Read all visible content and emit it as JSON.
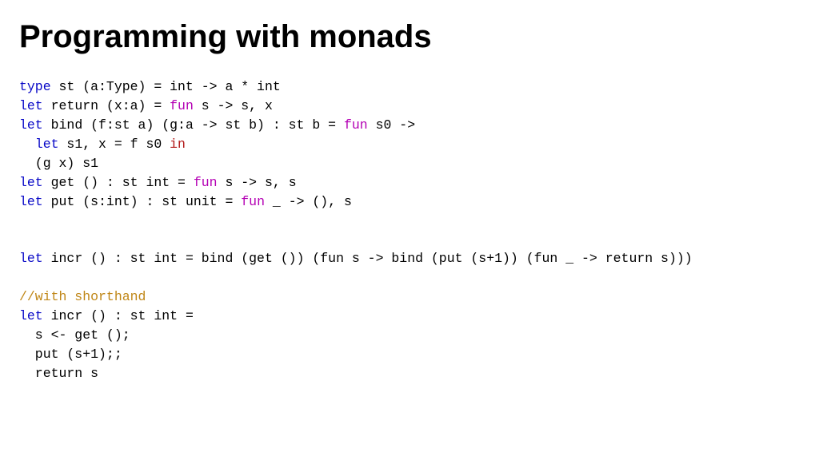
{
  "title": "Programming with monads",
  "code": {
    "l1": {
      "type": "type",
      "rest": " st (a:Type) = int -> a * int"
    },
    "l2": {
      "let": "let",
      "mid1": " return (x:a) = ",
      "fun": "fun",
      "rest": " s -> s, x"
    },
    "l3": {
      "let": "let",
      "mid1": " bind (f:st a) (g:a -> st b) : st b = ",
      "fun": "fun",
      "rest": " s0 ->"
    },
    "l4": {
      "pre": "  ",
      "let": "let",
      "mid": " s1, x = f s0 ",
      "in": "in"
    },
    "l5": "  (g x) s1",
    "l6": {
      "let": "let",
      "mid": " get () : st int = ",
      "fun": "fun",
      "rest": " s -> s, s"
    },
    "l7": {
      "let": "let",
      "mid": " put (s:int) : st unit = ",
      "fun": "fun",
      "rest": " _ -> (), s"
    },
    "l8": {
      "let": "let",
      "rest": " incr () : st int = bind (get ()) (fun s -> bind (put (s+1)) (fun _ -> return s)))"
    },
    "l9": "//with shorthand",
    "l10": {
      "let": "let",
      "rest": " incr () : st int ="
    },
    "l11": "  s <- get ();",
    "l12": "  put (s+1);;",
    "l13": "  return s"
  }
}
